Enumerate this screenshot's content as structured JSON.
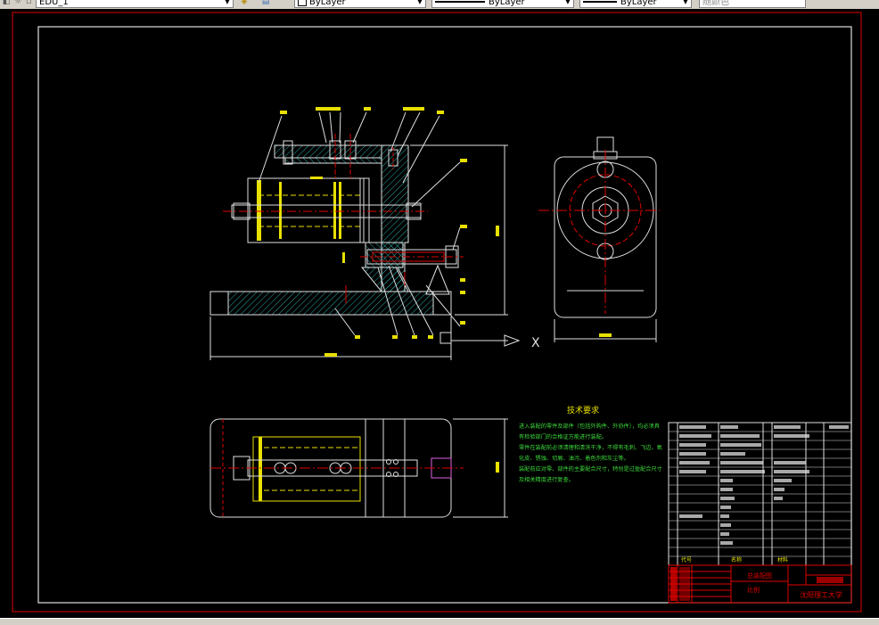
{
  "toolbar": {
    "layer_name": "EDU_1",
    "color_select": "ByLayer",
    "linetype_select": "ByLayer",
    "lineweight_select": "ByLayer",
    "plotstyle_select": "随颜色"
  },
  "drawing": {
    "tech_req_title": "技术要求",
    "tech_req_lines": [
      "进入装配的零件及部件（包括外购件、外协件），均必须具",
      "有检验部门的合格证方能进行装配。",
      "零件在装配前必须清理和清洗干净，不得有毛刺、飞边、氧",
      "化皮、锈蚀、切屑、油污、着色剂和灰尘等。",
      "装配前应对零、部件的主要配合尺寸，特别是过盈配合尺寸",
      "及相关精度进行复查。"
    ],
    "title_block": {
      "institution": "沈阳理工大学",
      "drawing_name": "总装配图",
      "scale_label": "比例",
      "header_code": "代号",
      "header_name": "名称",
      "header_material": "材料"
    },
    "section_marker": "X"
  }
}
